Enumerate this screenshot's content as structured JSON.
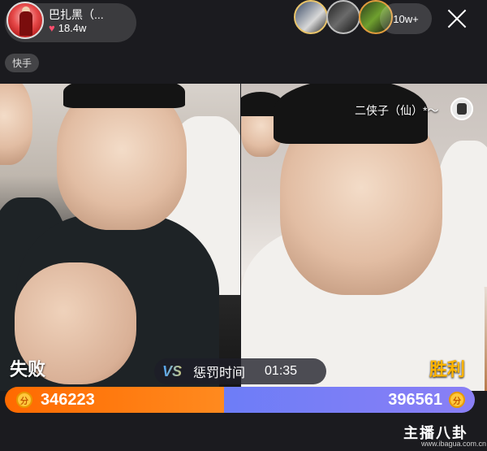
{
  "host": {
    "name": "巴扎黑（...",
    "likes": "18.4w"
  },
  "viewers": {
    "count": "10w+"
  },
  "platform_tag": "快手",
  "guest": {
    "name": "二侠子（仙）*～"
  },
  "battle": {
    "left_result": "失败",
    "right_result": "胜利",
    "vs_label": "VS",
    "penalty_label": "惩罚时间",
    "penalty_timer": "01:35",
    "left_score": "346223",
    "right_score": "396561",
    "left_share": 0.466,
    "left_color": "#ff6a00",
    "right_color": "#7b7ff6"
  },
  "icons": {
    "heart": "♥",
    "coin": "分",
    "close": "close-icon"
  },
  "watermark": {
    "logo": "主播八卦",
    "url": "www.ibagua.com.cn"
  }
}
